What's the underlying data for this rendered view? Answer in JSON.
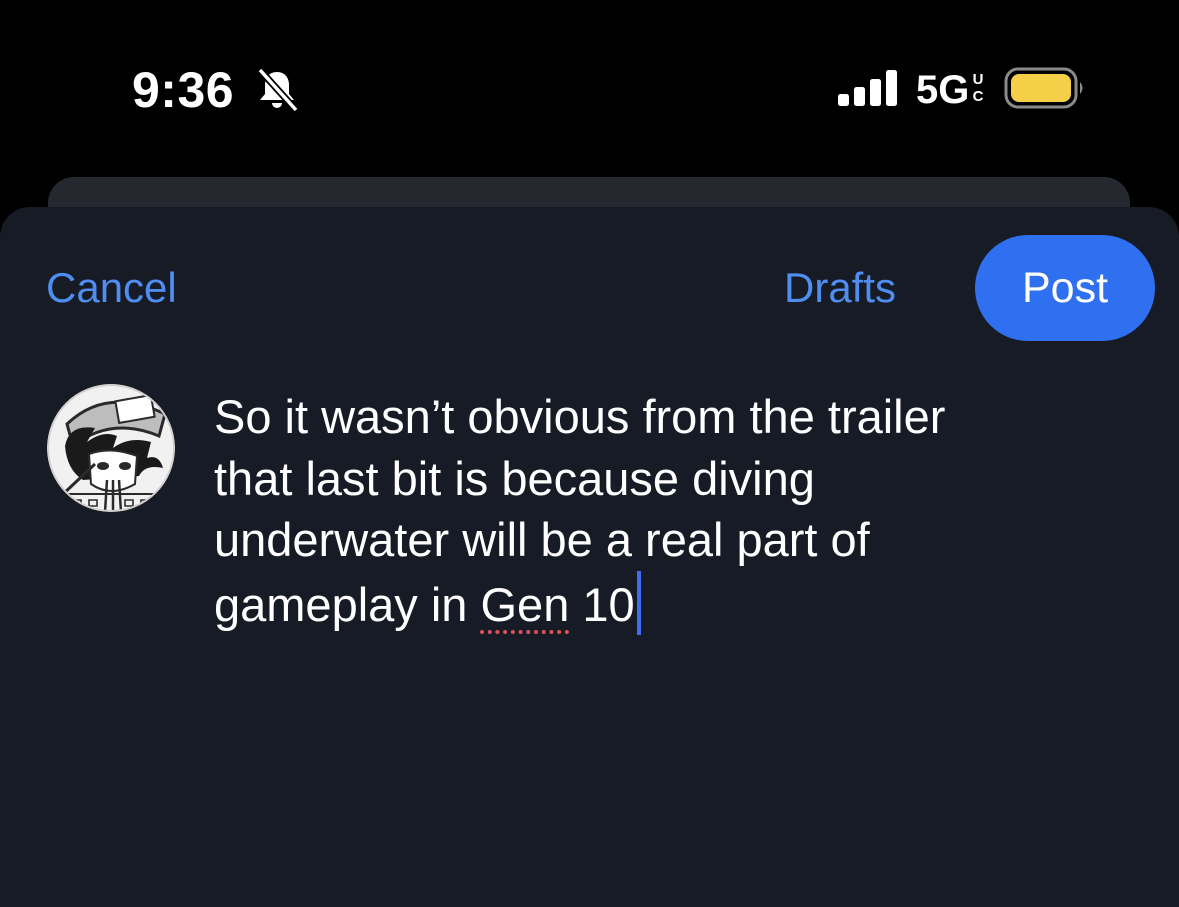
{
  "status_bar": {
    "time": "9:36",
    "network": "5G",
    "network_suffix_top": "U",
    "network_suffix_bottom": "C",
    "icons": [
      "bell-slash-icon",
      "cellular-signal-icon",
      "battery-icon"
    ],
    "battery_color": "#f4cf47"
  },
  "composer": {
    "cancel_label": "Cancel",
    "drafts_label": "Drafts",
    "post_label": "Post",
    "accent_color": "#4f8ef0",
    "post_button_color": "#2f70f0",
    "text_lines": [
      "So it wasn’t obvious from the trailer",
      "that last bit is because diving",
      "underwater will be a real part of",
      "gameplay in ",
      "Gen",
      " 10"
    ]
  }
}
